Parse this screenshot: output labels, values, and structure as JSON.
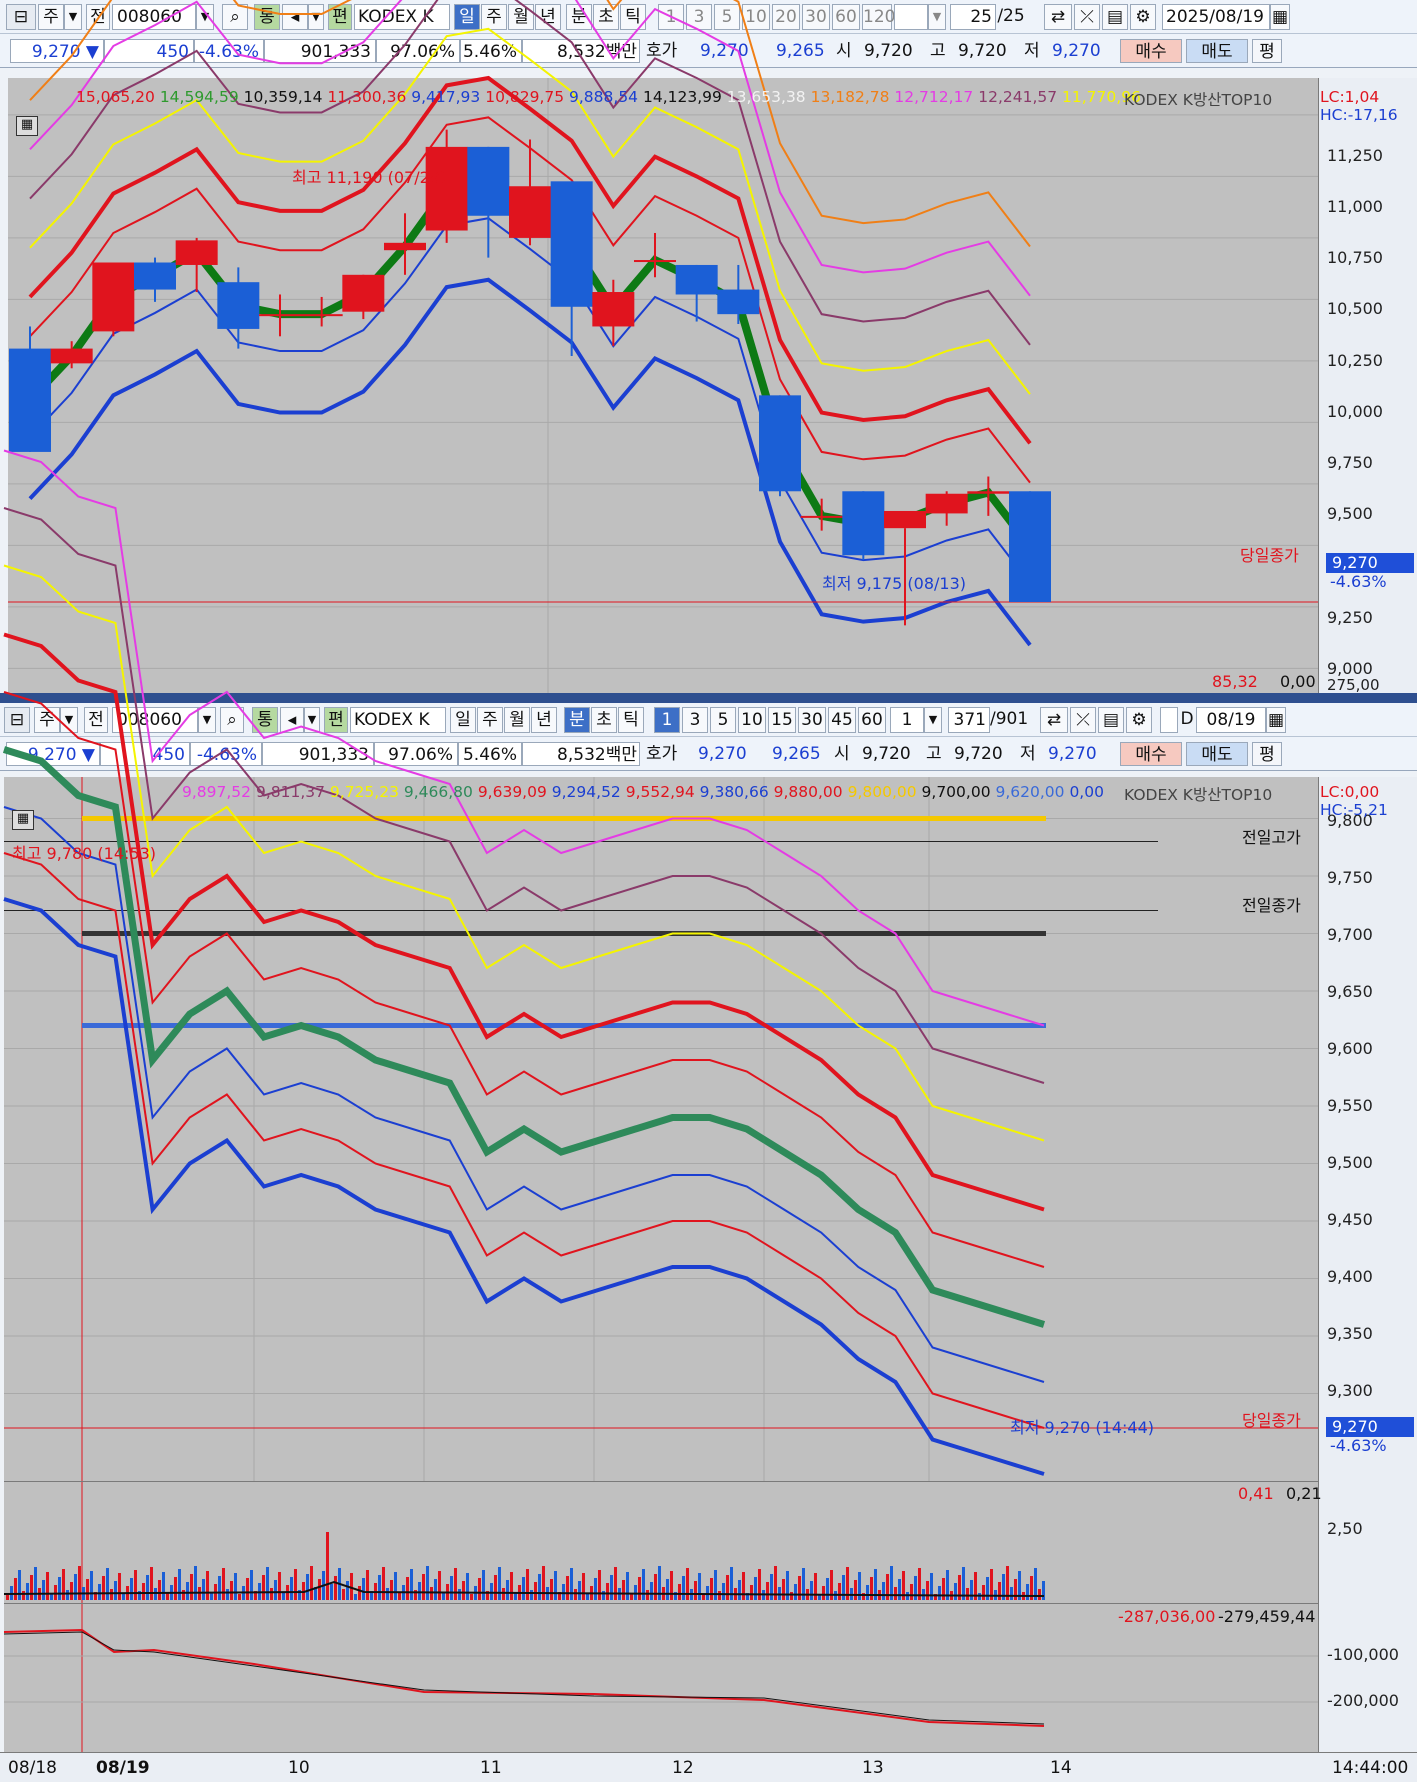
{
  "top_toolbar": {
    "period_ju": "주",
    "prev_label": "전",
    "code": "008060",
    "tong": "통",
    "pyeon": "편",
    "name": "KODEX K방산",
    "tabs": [
      "일",
      "주",
      "월",
      "년",
      "분",
      "초",
      "틱"
    ],
    "active_tab": "일",
    "nums": [
      "1",
      "3",
      "5",
      "10",
      "20",
      "30",
      "60",
      "120"
    ],
    "count": "25",
    "count_total": "/25",
    "date": "2025/08/19"
  },
  "top_quote": {
    "price": "9,270 ▼",
    "change": "450",
    "pct": "-4.63%",
    "volume": "901,333",
    "ratio": "97.06%",
    "turnover": "5.46%",
    "amount": "8,532백만",
    "hoga_label": "호가",
    "ask": "9,270",
    "bid": "9,265",
    "open_label": "시",
    "open": "9,720",
    "high_label": "고",
    "high": "9,720",
    "low_label": "저",
    "low": "9,270",
    "buy": "매수",
    "sell": "매도",
    "pyeong": "평"
  },
  "top_chart": {
    "legend": [
      {
        "text": "15,065,20",
        "color": "#e0141e"
      },
      {
        "text": "14,594,59",
        "color": "#2e9a2e"
      },
      {
        "text": "10,359,14",
        "color": "#111"
      },
      {
        "text": "11,300,36",
        "color": "#e0141e"
      },
      {
        "text": "9,417,93",
        "color": "#1b3fd1"
      },
      {
        "text": "10,829,75",
        "color": "#e0141e"
      },
      {
        "text": "9,888,54",
        "color": "#1b3fd1"
      },
      {
        "text": "14,123,99",
        "color": "#111"
      },
      {
        "text": "13,653,38",
        "color": "#f2f2f2"
      },
      {
        "text": "13,182,78",
        "color": "#f07f16"
      },
      {
        "text": "12,712,17",
        "color": "#e43ce4"
      },
      {
        "text": "12,241,57",
        "color": "#8a3a6a"
      },
      {
        "text": "11,770,96",
        "color": "#f4f400"
      }
    ],
    "title": "KODEX K방산TOP10",
    "lc": "LC:1,04",
    "hc": "HC:-17,16",
    "y_ticks": [
      "11,250",
      "11,000",
      "10,750",
      "10,500",
      "10,250",
      "10,000",
      "9,750",
      "9,500",
      "9,250",
      "9,000"
    ],
    "y_bottom": "275,00",
    "high_note": "최고 11,190 (07/29)",
    "low_note": "최저 9,175 (08/13)",
    "close_label": "당일종가",
    "last_price": "9,270",
    "last_pct": "-4.63%",
    "sub_value1": "85,32",
    "sub_value2": "0,00"
  },
  "bottom_toolbar": {
    "period_ju": "주",
    "prev_label": "전",
    "code": "008060",
    "tong": "통",
    "pyeon": "편",
    "name": "KODEX K방산",
    "tabs": [
      "일",
      "주",
      "월",
      "년",
      "분",
      "초",
      "틱"
    ],
    "active_tab": "분",
    "nums": [
      "1",
      "3",
      "5",
      "10",
      "15",
      "30",
      "45",
      "60"
    ],
    "interval": "1",
    "count": "371",
    "count_total": "/901",
    "d_label": "D",
    "date": "08/19"
  },
  "bottom_quote": {
    "price": "9,270 ▼",
    "change": "450",
    "pct": "-4.63%",
    "volume": "901,333",
    "ratio": "97.06%",
    "turnover": "5.46%",
    "amount": "8,532백만",
    "hoga_label": "호가",
    "ask": "9,270",
    "bid": "9,265",
    "open_label": "시",
    "open": "9,720",
    "high_label": "고",
    "high": "9,720",
    "low_label": "저",
    "low": "9,270",
    "buy": "매수",
    "sell": "매도",
    "pyeong": "평"
  },
  "bottom_chart": {
    "legend": [
      {
        "text": "9,897,52",
        "color": "#e43ce4"
      },
      {
        "text": "9,811,37",
        "color": "#8a3a6a"
      },
      {
        "text": "9,725,23",
        "color": "#f4f400"
      },
      {
        "text": "9,466,80",
        "color": "#2e8a5a"
      },
      {
        "text": "9,639,09",
        "color": "#e0141e"
      },
      {
        "text": "9,294,52",
        "color": "#1b3fd1"
      },
      {
        "text": "9,552,94",
        "color": "#e0141e"
      },
      {
        "text": "9,380,66",
        "color": "#1b3fd1"
      },
      {
        "text": "9,880,00",
        "color": "#e0141e"
      },
      {
        "text": "9,800,00",
        "color": "#f4c800"
      },
      {
        "text": "9,700,00",
        "color": "#111"
      },
      {
        "text": "9,620,00",
        "color": "#3a6ad8"
      },
      {
        "text": "0,00",
        "color": "#1b3fd1"
      }
    ],
    "title": "KODEX K방산TOP10",
    "lc": "LC:0,00",
    "hc": "HC:-5,21",
    "y_ticks": [
      "9,800",
      "9,750",
      "9,700",
      "9,650",
      "9,600",
      "9,550",
      "9,500",
      "9,450",
      "9,400",
      "9,350",
      "9,300"
    ],
    "high_note": "최고 9,780 (14:53)",
    "low_note": "최저 9,270 (14:44)",
    "prev_high_label": "전일고가",
    "prev_close_label": "전일종가",
    "close_label": "당일종가",
    "last_price": "9,270",
    "last_pct": "-4.63%"
  },
  "volume_panel": {
    "value1": "0,41",
    "value2": "0,21",
    "y_tick": "2,50"
  },
  "flow_panel": {
    "value1": "-287,036,00",
    "value2": "-279,459,44",
    "y_ticks": [
      "-100,000",
      "-200,000"
    ]
  },
  "x_axis": {
    "labels": [
      "08/18",
      "08/19",
      "10",
      "11",
      "12",
      "13",
      "14"
    ],
    "time": "14:44:00"
  },
  "chart_data": [
    {
      "type": "candlestick",
      "title": "KODEX K방산TOP10",
      "ylim": [
        8900,
        11400
      ],
      "candles": [
        {
          "o": 10300,
          "h": 10390,
          "l": 9880,
          "c": 9880
        },
        {
          "o": 10240,
          "h": 10330,
          "l": 10220,
          "c": 10300
        },
        {
          "o": 10370,
          "h": 10530,
          "l": 10350,
          "c": 10650
        },
        {
          "o": 10650,
          "h": 10670,
          "l": 10490,
          "c": 10540
        },
        {
          "o": 10640,
          "h": 10750,
          "l": 10530,
          "c": 10740
        },
        {
          "o": 10570,
          "h": 10630,
          "l": 10300,
          "c": 10380
        },
        {
          "o": 10440,
          "h": 10520,
          "l": 10350,
          "c": 10440
        },
        {
          "o": 10440,
          "h": 10510,
          "l": 10390,
          "c": 10440
        },
        {
          "o": 10450,
          "h": 10600,
          "l": 10420,
          "c": 10600
        },
        {
          "o": 10700,
          "h": 10850,
          "l": 10600,
          "c": 10730
        },
        {
          "o": 10780,
          "h": 11190,
          "l": 10730,
          "c": 11120
        },
        {
          "o": 11120,
          "h": 11120,
          "l": 10670,
          "c": 10840
        },
        {
          "o": 10750,
          "h": 11150,
          "l": 10720,
          "c": 10960
        },
        {
          "o": 10980,
          "h": 10980,
          "l": 10270,
          "c": 10470
        },
        {
          "o": 10390,
          "h": 10580,
          "l": 10310,
          "c": 10530
        },
        {
          "o": 10660,
          "h": 10770,
          "l": 10590,
          "c": 10660
        },
        {
          "o": 10640,
          "h": 10640,
          "l": 10410,
          "c": 10520
        },
        {
          "o": 10540,
          "h": 10640,
          "l": 10400,
          "c": 10440
        },
        {
          "o": 10110,
          "h": 10110,
          "l": 9700,
          "c": 9720
        },
        {
          "o": 9620,
          "h": 9690,
          "l": 9560,
          "c": 9620
        },
        {
          "o": 9720,
          "h": 9720,
          "l": 9440,
          "c": 9460
        },
        {
          "o": 9570,
          "h": 9570,
          "l": 9175,
          "c": 9640
        },
        {
          "o": 9630,
          "h": 9720,
          "l": 9580,
          "c": 9710
        },
        {
          "o": 9710,
          "h": 9780,
          "l": 9620,
          "c": 9720
        },
        {
          "o": 9720,
          "h": 9720,
          "l": 9270,
          "c": 9270
        }
      ],
      "close_line": 9270
    },
    {
      "type": "line",
      "title": "KODEX K방산TOP10",
      "ylim": [
        9250,
        9810
      ],
      "series": [
        {
          "name": "price",
          "values": [
            9770,
            9760,
            9730,
            9720,
            9500,
            9540,
            9560,
            9520,
            9530,
            9520,
            9500,
            9490,
            9480,
            9420,
            9440,
            9420,
            9430,
            9440,
            9450,
            9450,
            9440,
            9420,
            9400,
            9370,
            9350,
            9300,
            9290,
            9280,
            9270
          ]
        }
      ],
      "hlines": {
        "prev_high": 9780,
        "prev_close": 9720,
        "close": 9270
      }
    }
  ]
}
